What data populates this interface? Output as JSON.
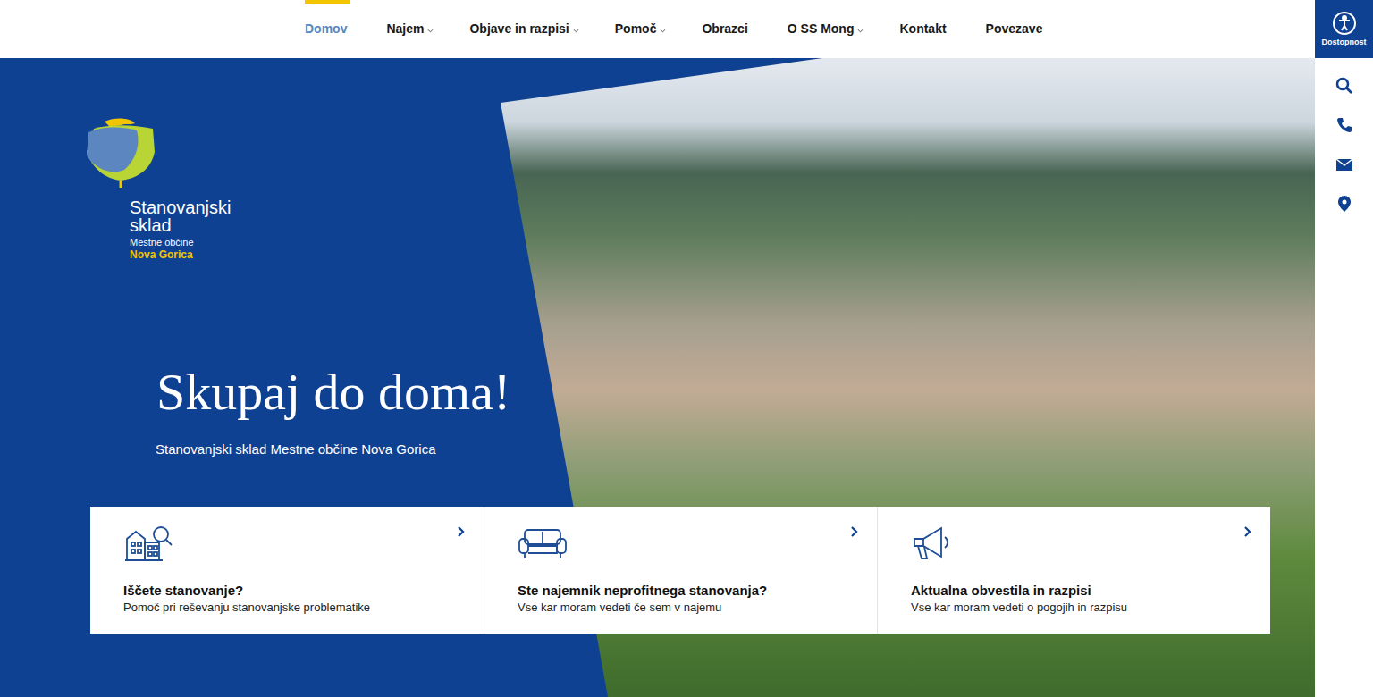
{
  "nav": {
    "items": [
      {
        "label": "Domov",
        "selected": true,
        "dropdown": false
      },
      {
        "label": "Najem",
        "selected": false,
        "dropdown": true
      },
      {
        "label": "Objave in razpisi",
        "selected": false,
        "dropdown": true
      },
      {
        "label": "Pomoč",
        "selected": false,
        "dropdown": true
      },
      {
        "label": "Obrazci",
        "selected": false,
        "dropdown": false
      },
      {
        "label": "O SS Mong",
        "selected": false,
        "dropdown": true
      },
      {
        "label": "Kontakt",
        "selected": false,
        "dropdown": false
      },
      {
        "label": "Povezave",
        "selected": false,
        "dropdown": false
      }
    ]
  },
  "accessibility": {
    "label": "Dostopnost"
  },
  "logo": {
    "line1": "Stanovanjski",
    "line2": "sklad",
    "line3": "Mestne občine",
    "line4": "Nova Gorica"
  },
  "hero": {
    "title": "Skupaj do doma!",
    "subtitle": "Stanovanjski sklad Mestne občine Nova Gorica"
  },
  "cards": [
    {
      "kind": "house",
      "title": "Iščete stanovanje?",
      "description": "Pomoč pri reševanju stanovanjske problematike"
    },
    {
      "kind": "sofa",
      "title": "Ste najemnik neprofitnega stanovanja?",
      "description": "Vse kar moram vedeti če sem v najemu"
    },
    {
      "kind": "megaphone",
      "title": "Aktualna obvestila in razpisi",
      "description": "Vse kar moram vedeti o pogojih in razpisu"
    }
  ]
}
